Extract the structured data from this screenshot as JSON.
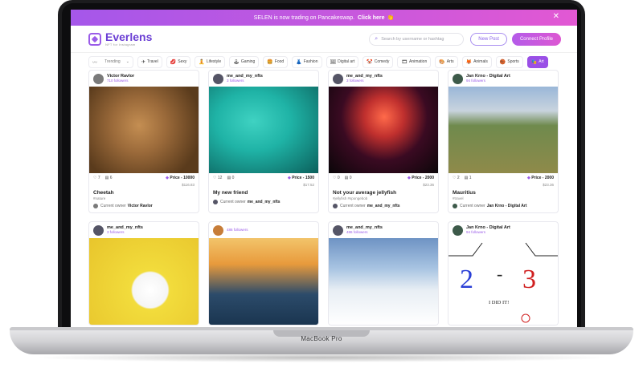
{
  "banner": {
    "text": "SELEN is now trading on Pancakeswap.",
    "link": "Click here",
    "emoji": "👏",
    "close": "✕"
  },
  "header": {
    "brand": "Everlens",
    "tagline": "NFT for Instagram",
    "search_placeholder": "Search by username or hashtag",
    "new_post": "New Post",
    "connect": "Connect Profile"
  },
  "categories": [
    {
      "label": "Trending",
      "icon": "trend-icon",
      "glyph": "〰"
    },
    {
      "label": "Travel",
      "icon": "airplane-icon",
      "glyph": "✈"
    },
    {
      "label": "Sexy",
      "icon": "lips-icon",
      "glyph": "💋"
    },
    {
      "label": "Lifestyle",
      "icon": "person-icon",
      "glyph": "🧘"
    },
    {
      "label": "Gaming",
      "icon": "joystick-icon",
      "glyph": "🕹"
    },
    {
      "label": "Food",
      "icon": "food-icon",
      "glyph": "🍔"
    },
    {
      "label": "Fashion",
      "icon": "dress-icon",
      "glyph": "👗"
    },
    {
      "label": "Digital art",
      "icon": "palette-icon",
      "glyph": "🖼"
    },
    {
      "label": "Comedy",
      "icon": "laugh-icon",
      "glyph": "🤡"
    },
    {
      "label": "Animation",
      "icon": "animation-icon",
      "glyph": "🎞"
    },
    {
      "label": "Arts",
      "icon": "brush-icon",
      "glyph": "🎨"
    },
    {
      "label": "Animals",
      "icon": "paw-icon",
      "glyph": "🦊"
    },
    {
      "label": "Sports",
      "icon": "ball-icon",
      "glyph": "🏀"
    },
    {
      "label": "Art",
      "icon": "art-icon",
      "glyph": "🎭"
    }
  ],
  "cards": [
    {
      "author": "Victor Ravlor",
      "followers": "710 followers",
      "likes": "7",
      "comments": "6",
      "price": "Price - 10000",
      "usd": "$116.83",
      "title": "Cheetah",
      "tags": "#nature",
      "owner_label": "Current owner",
      "owner": "Victor Ravlor",
      "colors": [
        "#9b6a3a",
        "#5a3b1c"
      ],
      "avatar": "#7a7a7a"
    },
    {
      "author": "me_and_my_nfts",
      "followers": "3 followers",
      "likes": "12",
      "comments": "0",
      "price": "Price - 1500",
      "usd": "$17.52",
      "title": "My new friend",
      "tags": "",
      "owner_label": "Current owner",
      "owner": "me_and_my_nfts",
      "colors": [
        "#1fb3a6",
        "#0b5e5a"
      ],
      "avatar": "#556"
    },
    {
      "author": "me_and_my_nfts",
      "followers": "3 followers",
      "likes": "0",
      "comments": "0",
      "price": "Price - 2000",
      "usd": "$23.36",
      "title": "Not your average jellyfish",
      "tags": "#jellyfish #spongebob",
      "owner_label": "Current owner",
      "owner": "me_and_my_nfts",
      "colors": [
        "#c0302e",
        "#0a0608"
      ],
      "avatar": "#556"
    },
    {
      "author": "Jan Krno - Digital Art",
      "followers": "94 followers",
      "likes": "2",
      "comments": "1",
      "price": "Price - 2000",
      "usd": "$23.36",
      "title": "Mauritius",
      "tags": "#travel",
      "owner_label": "Current owner",
      "owner": "Jan Krno - Digital Art",
      "colors": [
        "#8aa6c8",
        "#6f7b3d"
      ],
      "avatar": "#3d5a4a"
    },
    {
      "author": "me_and_my_nfts",
      "followers": "3 followers",
      "colors": [
        "#f2dc3c",
        "#e8c52c"
      ],
      "avatar": "#556"
    },
    {
      "author": "",
      "followers": "486 followers",
      "colors": [
        "#f2c46a",
        "#2c4b6a"
      ],
      "avatar": "#c77d38"
    },
    {
      "author": "me_and_my_nfts",
      "followers": "486 followers",
      "colors": [
        "#cfe0f0",
        "#5f87b8"
      ],
      "avatar": "#556"
    },
    {
      "author": "Jan Krno - Digital Art",
      "followers": "94 followers",
      "colors": [
        "#ffffff",
        "#ffffff"
      ],
      "avatar": "#3d5a4a"
    }
  ],
  "drawing": {
    "score_left": "2",
    "score_dash": "-",
    "score_right": "3",
    "caption": "I DID IT!"
  },
  "laptop_label": "MacBook Pro"
}
